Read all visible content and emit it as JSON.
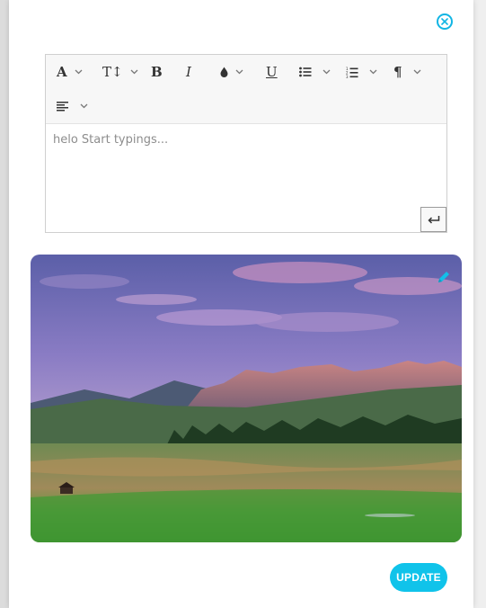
{
  "editor": {
    "placeholder_text": "helo Start typings...",
    "toolbar": [
      {
        "name": "font-family",
        "icon": "font-a-icon",
        "glyph": "A",
        "dropdown": true
      },
      {
        "name": "font-size",
        "icon": "text-size-icon",
        "glyph": "T↕",
        "dropdown": true
      },
      {
        "name": "bold",
        "icon": "bold-icon",
        "glyph": "B",
        "dropdown": false
      },
      {
        "name": "italic",
        "icon": "italic-icon",
        "glyph": "I",
        "dropdown": false
      },
      {
        "name": "color",
        "icon": "color-drop-icon",
        "glyph": "",
        "dropdown": true
      },
      {
        "name": "underline",
        "icon": "underline-icon",
        "glyph": "U",
        "dropdown": false
      },
      {
        "name": "bullet-list",
        "icon": "bullet-list-icon",
        "glyph": "",
        "dropdown": true
      },
      {
        "name": "numbered-list",
        "icon": "numbered-list-icon",
        "glyph": "",
        "dropdown": true
      },
      {
        "name": "paragraph",
        "icon": "pilcrow-icon",
        "glyph": "¶",
        "dropdown": true
      },
      {
        "name": "align",
        "icon": "align-left-icon",
        "glyph": "",
        "dropdown": true
      }
    ]
  },
  "image": {
    "subject": "mountain landscape at dusk"
  },
  "actions": {
    "update_label": "UPDATE"
  },
  "colors": {
    "accent": "#10c3ea",
    "close": "#11b5e4"
  }
}
